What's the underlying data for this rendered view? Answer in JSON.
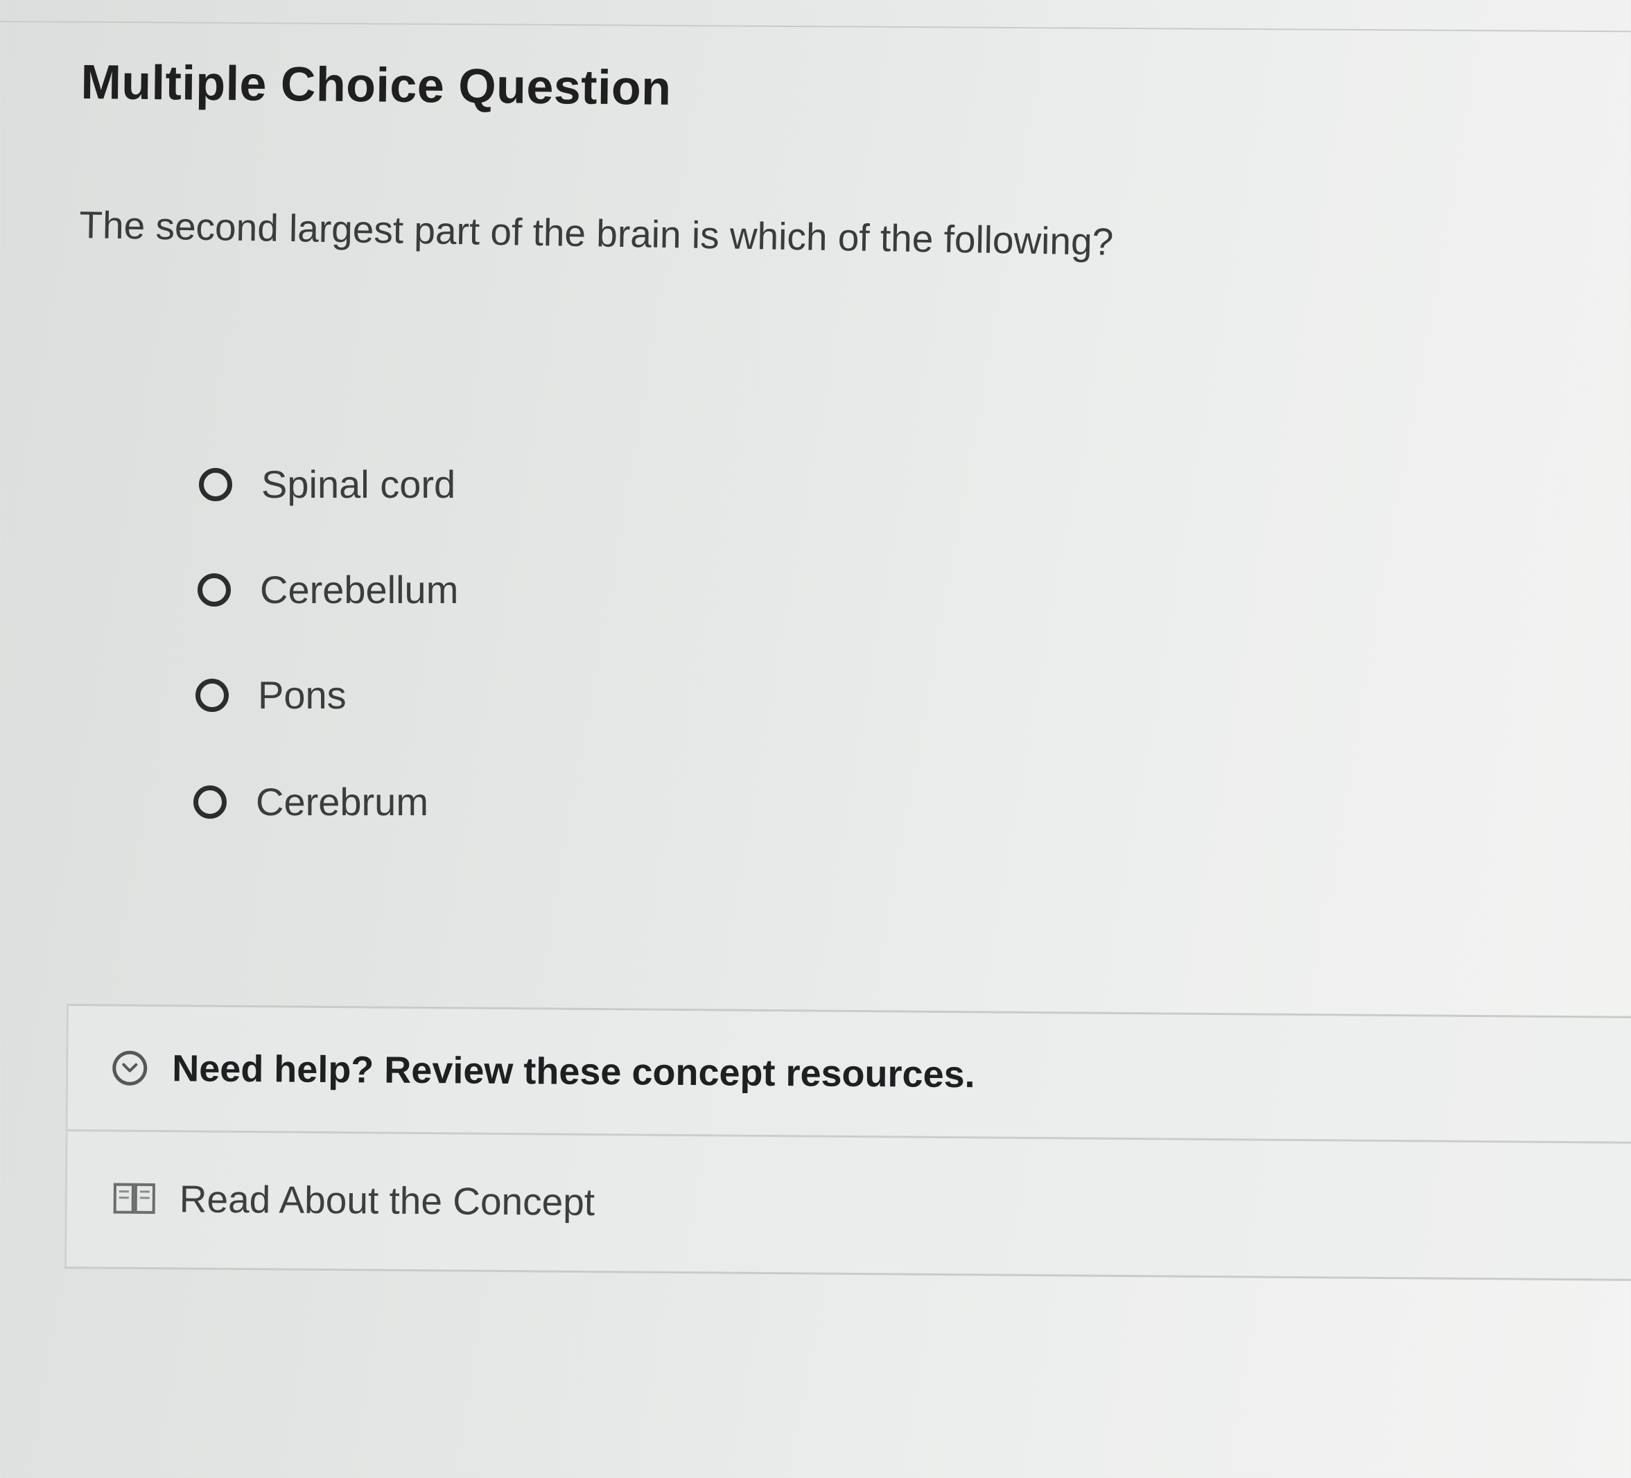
{
  "question": {
    "heading": "Multiple Choice Question",
    "prompt": "The second largest part of the brain is which of the following?",
    "choices": [
      {
        "label": "Spinal cord",
        "selected": false
      },
      {
        "label": "Cerebellum",
        "selected": false
      },
      {
        "label": "Pons",
        "selected": false
      },
      {
        "label": "Cerebrum",
        "selected": false
      }
    ]
  },
  "help": {
    "title": "Need help? Review these concept resources.",
    "toggle_icon": "chevron-down-circle-icon",
    "resources": [
      {
        "icon": "book-icon",
        "label": "Read About the Concept"
      }
    ]
  }
}
